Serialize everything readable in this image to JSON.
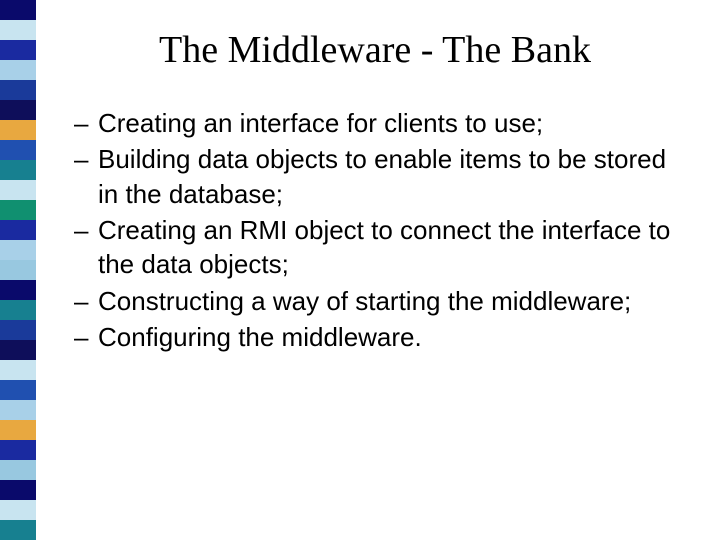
{
  "sidebar_colors": [
    "#0a0a6b",
    "#c8e4f0",
    "#1a2aa0",
    "#a8d0e8",
    "#1a3a9a",
    "#0e0e5a",
    "#e8a840",
    "#2050b0",
    "#178090",
    "#c8e4f0",
    "#109070",
    "#1a2aa0",
    "#a8d0e8",
    "#98c8e0",
    "#0a0a6b",
    "#178090",
    "#1a3a9a",
    "#0e0e5a",
    "#c8e4f0",
    "#2050b0",
    "#a8d0e8",
    "#e8a840",
    "#1a2aa0",
    "#98c8e0",
    "#0a0a6b",
    "#c8e4f0",
    "#178090"
  ],
  "slide": {
    "title": "The Middleware - The Bank",
    "bullets": [
      "Creating an interface for clients to use;",
      "Building data objects to enable items to be stored in the database;",
      "Creating an RMI object to connect the interface to the data objects;",
      "Constructing a way of starting the middleware;",
      "Configuring the middleware."
    ]
  }
}
